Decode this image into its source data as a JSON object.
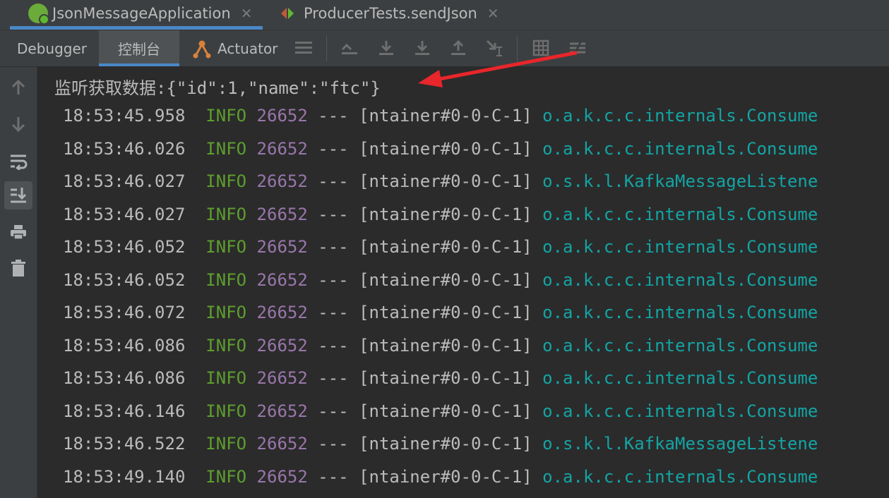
{
  "run_tabs": [
    {
      "label": "JsonMessageApplication",
      "icon": "spring-boot-icon",
      "active": true
    },
    {
      "label": "ProducerTests.sendJson",
      "icon": "test-run-icon",
      "active": false
    }
  ],
  "close_glyph": "✕",
  "toolbar": {
    "tabs": [
      {
        "label": "Debugger"
      },
      {
        "label": "控制台",
        "active": true
      },
      {
        "label": "Actuator"
      }
    ],
    "icons": [
      "menu-icon",
      "show-execution-point-icon",
      "step-over-icon",
      "step-into-icon",
      "step-out-icon",
      "run-to-cursor-icon",
      "evaluate-expression-icon",
      "trace-icon"
    ]
  },
  "gutter_icons": [
    "up-arrow-icon",
    "down-arrow-icon",
    "soft-wrap-icon",
    "scroll-to-end-icon",
    "print-icon",
    "clear-all-icon"
  ],
  "console": {
    "output_line": "监听获取数据:{\"id\":1,\"name\":\"ftc\"}",
    "log_lines": [
      {
        "time": "18:53:45.958",
        "level": "INFO",
        "pid": "26652",
        "sep": "---",
        "thread": "[ntainer#0-0-C-1]",
        "logger": "o.a.k.c.c.internals.Consume"
      },
      {
        "time": "18:53:46.026",
        "level": "INFO",
        "pid": "26652",
        "sep": "---",
        "thread": "[ntainer#0-0-C-1]",
        "logger": "o.a.k.c.c.internals.Consume"
      },
      {
        "time": "18:53:46.027",
        "level": "INFO",
        "pid": "26652",
        "sep": "---",
        "thread": "[ntainer#0-0-C-1]",
        "logger": "o.s.k.l.KafkaMessageListene"
      },
      {
        "time": "18:53:46.027",
        "level": "INFO",
        "pid": "26652",
        "sep": "---",
        "thread": "[ntainer#0-0-C-1]",
        "logger": "o.a.k.c.c.internals.Consume"
      },
      {
        "time": "18:53:46.052",
        "level": "INFO",
        "pid": "26652",
        "sep": "---",
        "thread": "[ntainer#0-0-C-1]",
        "logger": "o.a.k.c.c.internals.Consume"
      },
      {
        "time": "18:53:46.052",
        "level": "INFO",
        "pid": "26652",
        "sep": "---",
        "thread": "[ntainer#0-0-C-1]",
        "logger": "o.a.k.c.c.internals.Consume"
      },
      {
        "time": "18:53:46.072",
        "level": "INFO",
        "pid": "26652",
        "sep": "---",
        "thread": "[ntainer#0-0-C-1]",
        "logger": "o.a.k.c.c.internals.Consume"
      },
      {
        "time": "18:53:46.086",
        "level": "INFO",
        "pid": "26652",
        "sep": "---",
        "thread": "[ntainer#0-0-C-1]",
        "logger": "o.a.k.c.c.internals.Consume"
      },
      {
        "time": "18:53:46.086",
        "level": "INFO",
        "pid": "26652",
        "sep": "---",
        "thread": "[ntainer#0-0-C-1]",
        "logger": "o.a.k.c.c.internals.Consume"
      },
      {
        "time": "18:53:46.146",
        "level": "INFO",
        "pid": "26652",
        "sep": "---",
        "thread": "[ntainer#0-0-C-1]",
        "logger": "o.a.k.c.c.internals.Consume"
      },
      {
        "time": "18:53:46.522",
        "level": "INFO",
        "pid": "26652",
        "sep": "---",
        "thread": "[ntainer#0-0-C-1]",
        "logger": "o.s.k.l.KafkaMessageListene"
      },
      {
        "time": "18:53:49.140",
        "level": "INFO",
        "pid": "26652",
        "sep": "---",
        "thread": "[ntainer#0-0-C-1]",
        "logger": "o.a.k.c.c.internals.Consume"
      }
    ]
  },
  "colors": {
    "background": "#2b2b2b",
    "toolbar": "#3c3f41",
    "accent": "#4a88c7",
    "info_level": "#5d9e2e",
    "pid": "#9876aa",
    "logger": "#14a4a4",
    "annotation_arrow": "#e8262b"
  }
}
